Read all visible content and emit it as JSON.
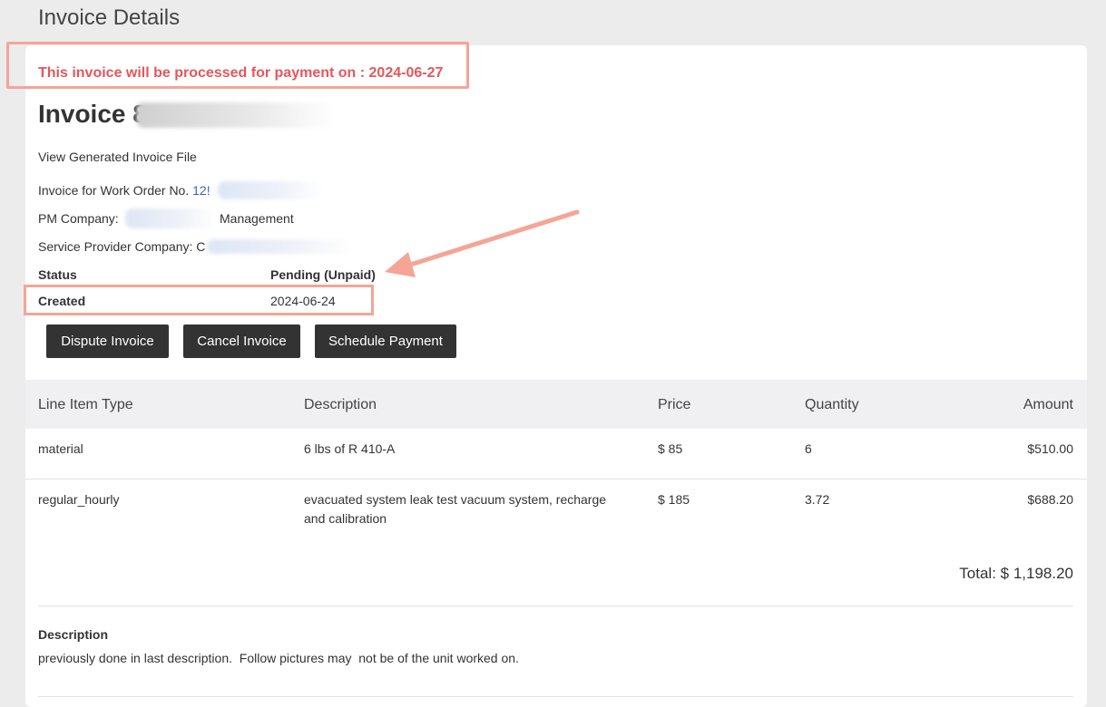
{
  "page": {
    "title": "Invoice Details"
  },
  "notice": {
    "text": "This invoice will be processed for payment on : 2024-06-27"
  },
  "invoice": {
    "title_prefix": "Invoice 8",
    "view_file_link": "View Generated Invoice File",
    "work_order_label": "Invoice for Work Order No.",
    "work_order_value": "12!",
    "pm_company_label": "PM Company:",
    "pm_company_value": "Management",
    "service_provider_label": "Service Provider Company:",
    "service_provider_value": "C",
    "status_label": "Status",
    "status_value": "Pending (Unpaid)",
    "created_label": "Created",
    "created_value": "2024-06-24"
  },
  "buttons": {
    "dispute": "Dispute Invoice",
    "cancel": "Cancel Invoice",
    "schedule": "Schedule Payment"
  },
  "table": {
    "headers": [
      "Line Item Type",
      "Description",
      "Price",
      "Quantity",
      "Amount"
    ],
    "rows": [
      {
        "type": "material",
        "description": "6 lbs of R 410-A",
        "price": "$ 85",
        "quantity": "6",
        "amount": "$510.00"
      },
      {
        "type": "regular_hourly",
        "description": "evacuated system leak test vacuum system, recharge",
        "description2": "and calibration",
        "price": "$ 185",
        "quantity": "3.72",
        "amount": "$688.20"
      }
    ],
    "total": "Total: $ 1,198.20"
  },
  "description": {
    "label": "Description",
    "text": "previously done in last description.  Follow pictures may  not be of the unit worked on."
  },
  "colors": {
    "accent_link": "#3a64b3",
    "notice_red": "#e4575c",
    "highlight_box": "#f4a596",
    "button_bg": "#333333"
  }
}
